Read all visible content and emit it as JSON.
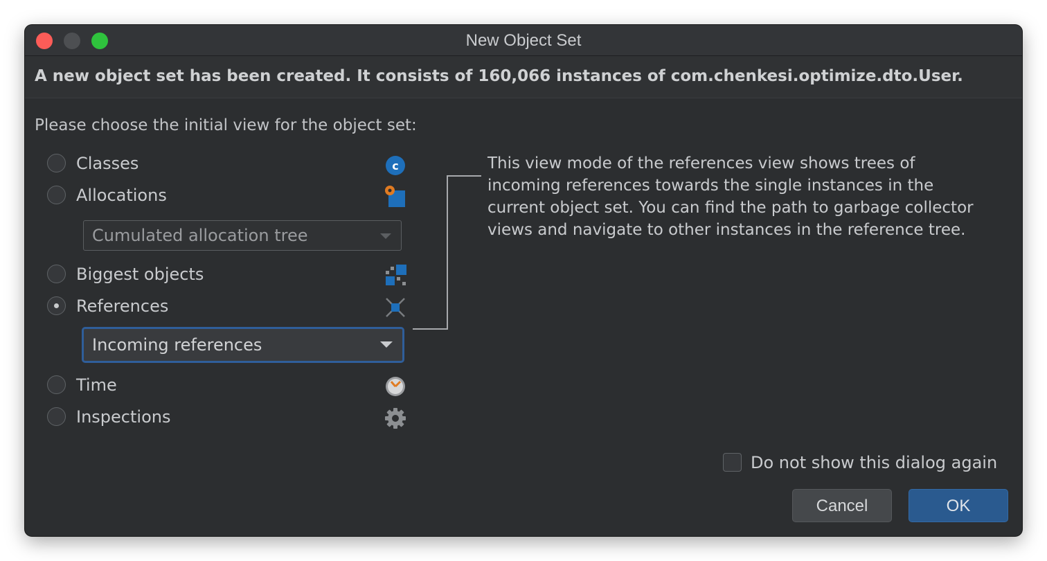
{
  "window": {
    "title": "New Object Set"
  },
  "info": {
    "message": "A new object set has been created. It consists of 160,066 instances of com.chenkesi.optimize.dto.User."
  },
  "prompt": "Please choose the initial view for the object set:",
  "options": [
    {
      "label": "Classes",
      "icon": "class-c-icon",
      "selected": false
    },
    {
      "label": "Allocations",
      "icon": "allocations-icon",
      "selected": false
    },
    {
      "label": "Biggest objects",
      "icon": "biggest-objects-icon",
      "selected": false
    },
    {
      "label": "References",
      "icon": "references-icon",
      "selected": true
    },
    {
      "label": "Time",
      "icon": "clock-icon",
      "selected": false
    },
    {
      "label": "Inspections",
      "icon": "gear-icon",
      "selected": false
    }
  ],
  "allocations_combo": {
    "value": "Cumulated allocation tree",
    "enabled": false
  },
  "references_combo": {
    "value": "Incoming references",
    "enabled": true
  },
  "description": "This view mode of the references view shows trees of incoming references towards the single instances in the current object set. You can find the path to garbage collector views and navigate to other instances in the reference tree.",
  "dont_show_again": {
    "label": "Do not show this dialog again",
    "checked": false
  },
  "buttons": {
    "cancel": "Cancel",
    "ok": "OK"
  },
  "colors": {
    "background": "#2c2e30",
    "accent": "#2a5a8f",
    "focus_ring": "#2f5e9a",
    "icon_blue": "#1e6fba",
    "icon_orange": "#e07b22"
  }
}
